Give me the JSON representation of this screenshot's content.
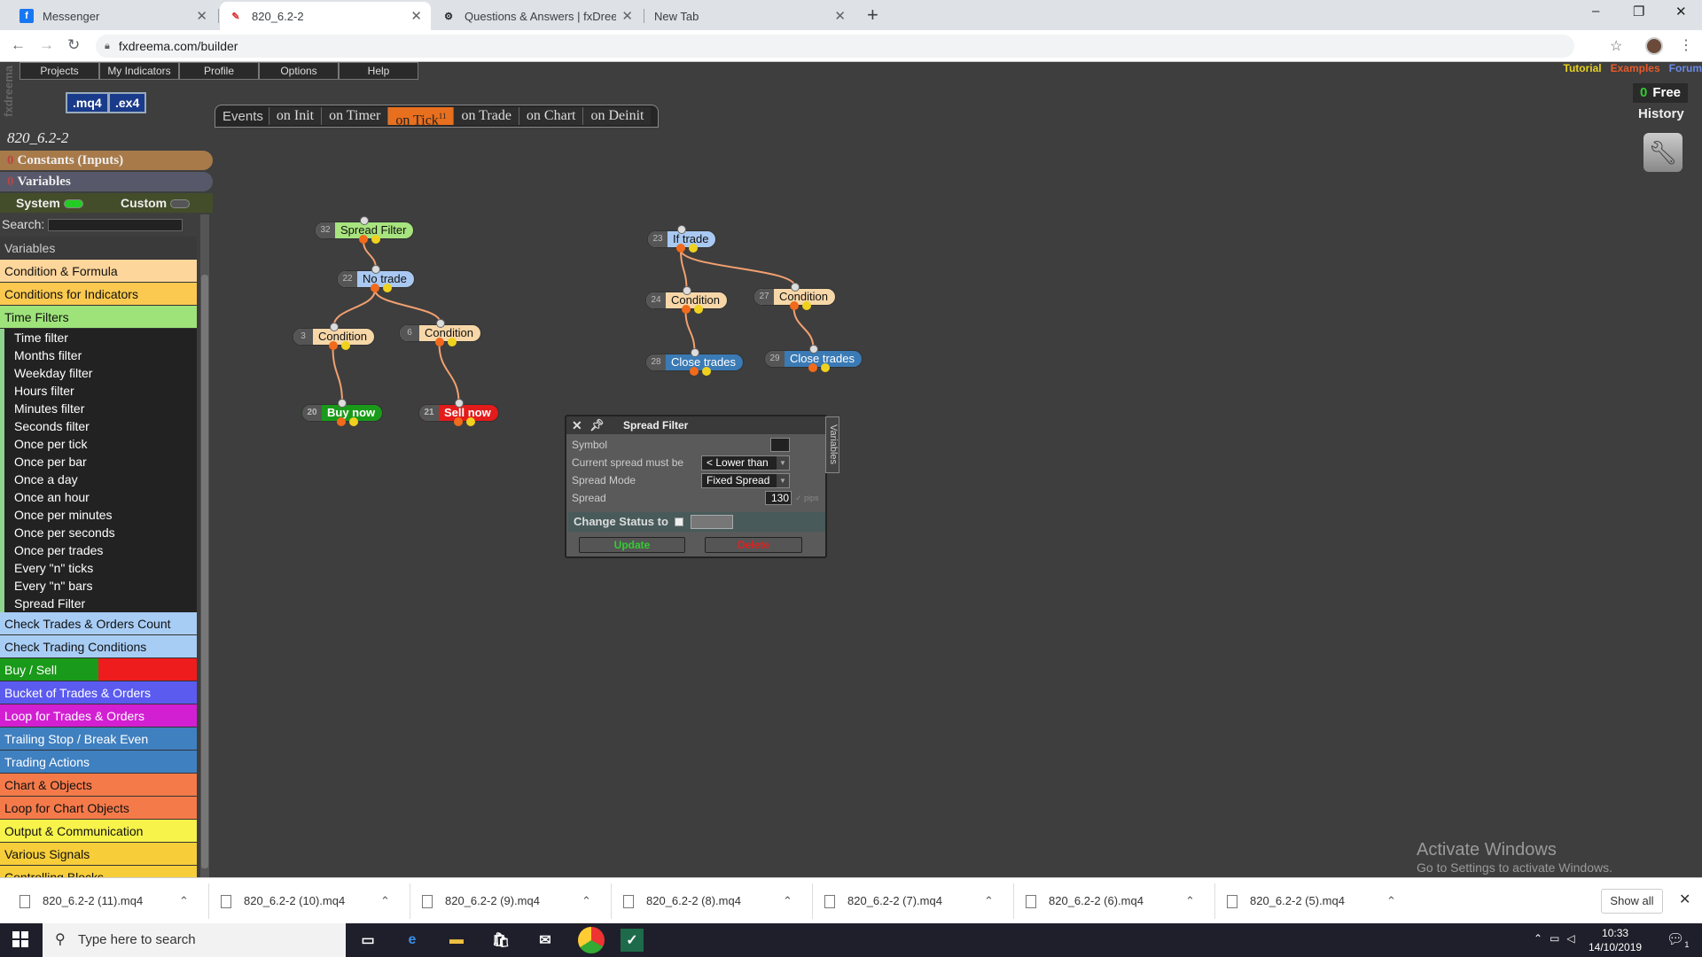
{
  "browser": {
    "tabs": [
      {
        "title": "Messenger",
        "icon": "facebook-icon",
        "active": false
      },
      {
        "title": "820_6.2-2",
        "icon": "fxdreema-icon",
        "active": true
      },
      {
        "title": "Questions & Answers | fxDreema",
        "icon": "fxdreema-gear-icon",
        "active": false
      },
      {
        "title": "New Tab",
        "icon": "",
        "active": false
      }
    ],
    "url": "fxdreema.com/builder"
  },
  "app": {
    "brand": "fxdreema",
    "menu": [
      "Projects",
      "My Indicators",
      "Profile",
      "Options",
      "Help"
    ],
    "download_buttons": [
      ".mq4",
      ".ex4"
    ],
    "top_links": [
      {
        "label": "Tutorial",
        "color": "#e6d21e"
      },
      {
        "label": "Examples",
        "color": "#e85a2a"
      },
      {
        "label": "Forum",
        "color": "#6a8ae8"
      }
    ],
    "credits": {
      "count": "0",
      "label": "Free"
    },
    "history_label": "History",
    "events": {
      "label": "Events",
      "tabs": [
        {
          "label": "on Init",
          "active": false,
          "count": ""
        },
        {
          "label": "on Timer",
          "active": false,
          "count": ""
        },
        {
          "label": "on Tick",
          "active": true,
          "count": "11"
        },
        {
          "label": "on Trade",
          "active": false,
          "count": ""
        },
        {
          "label": "on Chart",
          "active": false,
          "count": ""
        },
        {
          "label": "on Deinit",
          "active": false,
          "count": ""
        }
      ]
    },
    "project_title": "820_6.2-2",
    "constants_label": "Constants (Inputs)",
    "constants_count": "0",
    "variables_label": "Variables",
    "variables_count": "0",
    "system_label": "System",
    "custom_label": "Custom",
    "search_label": "Search:",
    "categories": [
      {
        "label": "Variables",
        "bg": "#3a3a3a",
        "fg": "#ccc",
        "subs": []
      },
      {
        "label": "Condition & Formula",
        "bg": "#fdd69b",
        "fg": "#111",
        "subs": []
      },
      {
        "label": "Conditions for Indicators",
        "bg": "#fbc94f",
        "fg": "#111",
        "subs": []
      },
      {
        "label": "Time Filters",
        "bg": "#9ee37a",
        "fg": "#111",
        "subs": [
          "Time filter",
          "Months filter",
          "Weekday filter",
          "Hours filter",
          "Minutes filter",
          "Seconds filter",
          "Once per tick",
          "Once per bar",
          "Once a day",
          "Once an hour",
          "Once per minutes",
          "Once per seconds",
          "Once per trades",
          "Every \"n\" ticks",
          "Every \"n\" bars",
          "Spread Filter"
        ]
      },
      {
        "label": "Check Trades & Orders Count",
        "bg": "#a8cdf5",
        "fg": "#111",
        "subs": []
      },
      {
        "label": "Check Trading Conditions",
        "bg": "#a8cdf5",
        "fg": "#111",
        "subs": []
      },
      {
        "label": "Buy / Sell",
        "bg": "linear-gradient(90deg,#1a9a1a 50%,#ee1c1c 50%)",
        "fg": "#fff",
        "subs": []
      },
      {
        "label": "Bucket of Trades & Orders",
        "bg": "#5b5bf0",
        "fg": "#fff",
        "subs": []
      },
      {
        "label": "Loop for Trades & Orders",
        "bg": "#d21fd2",
        "fg": "#fff",
        "subs": []
      },
      {
        "label": "Trailing Stop / Break Even",
        "bg": "#3f80c0",
        "fg": "#fff",
        "subs": []
      },
      {
        "label": "Trading Actions",
        "bg": "#3f80c0",
        "fg": "#fff",
        "subs": []
      },
      {
        "label": "Chart & Objects",
        "bg": "#f57a4a",
        "fg": "#111",
        "subs": []
      },
      {
        "label": "Loop for Chart Objects",
        "bg": "#f57a4a",
        "fg": "#111",
        "subs": []
      },
      {
        "label": "Output & Communication",
        "bg": "#f7f34a",
        "fg": "#111",
        "subs": []
      },
      {
        "label": "Various Signals",
        "bg": "#f7ce3a",
        "fg": "#111",
        "subs": []
      },
      {
        "label": "Controlling Blocks",
        "bg": "#f7ce3a",
        "fg": "#111",
        "subs": []
      }
    ],
    "blocks": [
      {
        "id": "32",
        "label": "Spread Filter",
        "kind": "green"
      },
      {
        "id": "22",
        "label": "No trade",
        "kind": "blue"
      },
      {
        "id": "3",
        "label": "Condition",
        "kind": "cond"
      },
      {
        "id": "6",
        "label": "Condition",
        "kind": "cond"
      },
      {
        "id": "20",
        "label": "Buy now",
        "kind": "buy"
      },
      {
        "id": "21",
        "label": "Sell now",
        "kind": "sell"
      },
      {
        "id": "23",
        "label": "If trade",
        "kind": "blue"
      },
      {
        "id": "24",
        "label": "Condition",
        "kind": "cond"
      },
      {
        "id": "27",
        "label": "Condition",
        "kind": "cond"
      },
      {
        "id": "28",
        "label": "Close trades",
        "kind": "close"
      },
      {
        "id": "29",
        "label": "Close trades",
        "kind": "close"
      }
    ],
    "dialog": {
      "title": "Spread Filter",
      "side_tab": "Variables",
      "symbol_label": "Symbol",
      "symbol_value": "",
      "current_spread_label": "Current spread must be",
      "current_spread_value": "< Lower than",
      "spread_mode_label": "Spread Mode",
      "spread_mode_value": "Fixed Spread",
      "spread_label": "Spread",
      "spread_value": "130",
      "spread_unit": "pips",
      "change_status_label": "Change Status to",
      "update_label": "Update",
      "delete_label": "Delete"
    },
    "watermark": {
      "line1": "Activate Windows",
      "line2": "Go to Settings to activate Windows."
    }
  },
  "downloads": {
    "items": [
      "820_6.2-2 (11).mq4",
      "820_6.2-2 (10).mq4",
      "820_6.2-2 (9).mq4",
      "820_6.2-2 (8).mq4",
      "820_6.2-2 (7).mq4",
      "820_6.2-2 (6).mq4",
      "820_6.2-2 (5).mq4"
    ],
    "show_all": "Show all"
  },
  "taskbar": {
    "search_placeholder": "Type here to search",
    "time": "10:33",
    "date": "14/10/2019",
    "notification_count": "1"
  }
}
